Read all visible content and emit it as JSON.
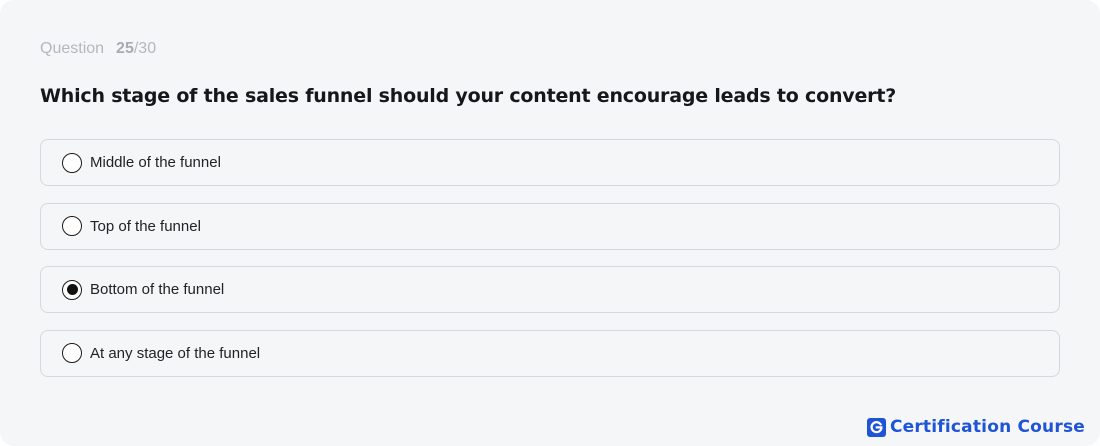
{
  "counter": {
    "label": "Question",
    "current": "25",
    "total": "/30"
  },
  "question": {
    "text": "Which stage of the sales funnel should your content encourage leads to convert?"
  },
  "options": [
    {
      "label": "Middle of the funnel",
      "selected": false
    },
    {
      "label": "Top of the funnel",
      "selected": false
    },
    {
      "label": "Bottom of the funnel",
      "selected": true
    },
    {
      "label": "At any stage of the funnel",
      "selected": false
    }
  ],
  "brand": {
    "icon": "g-logo-icon",
    "text": "Certification Course",
    "color": "#1f54d6"
  }
}
